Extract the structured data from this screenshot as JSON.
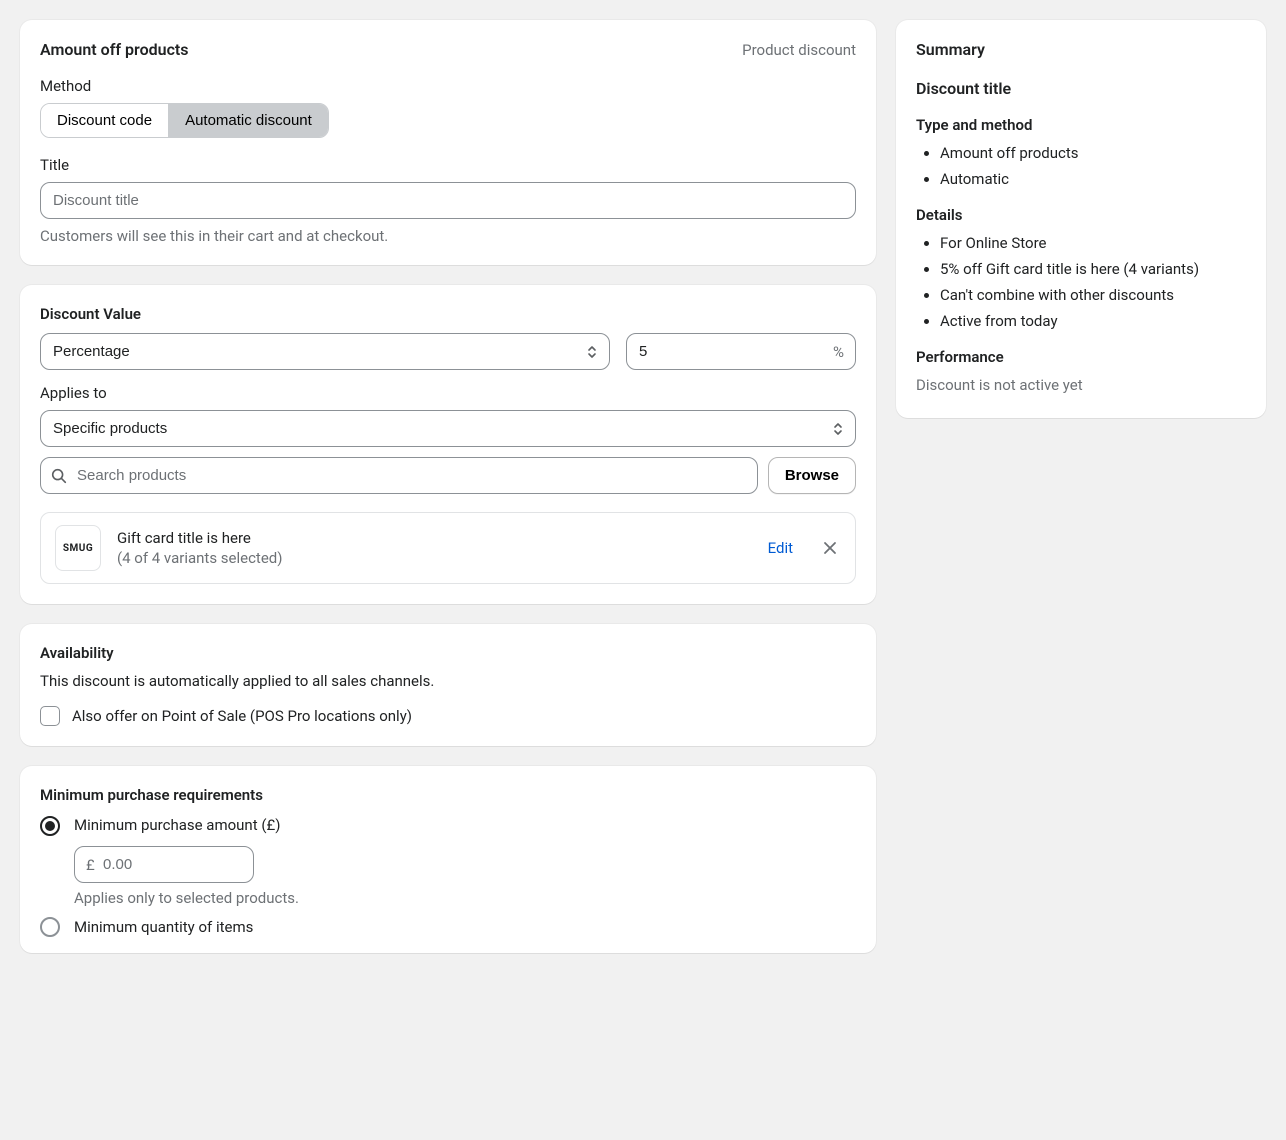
{
  "header": {
    "title": "Amount off products",
    "type_label": "Product discount"
  },
  "method": {
    "label": "Method",
    "options": [
      "Discount code",
      "Automatic discount"
    ],
    "selected_index": 1
  },
  "title_field": {
    "label": "Title",
    "placeholder": "Discount title",
    "value": "",
    "help": "Customers will see this in their cart and at checkout."
  },
  "discount_value": {
    "heading": "Discount Value",
    "type_options": [
      "Percentage"
    ],
    "type_selected": "Percentage",
    "amount": "5",
    "suffix": "%"
  },
  "applies_to": {
    "label": "Applies to",
    "options": [
      "Specific products"
    ],
    "selected": "Specific products",
    "search_placeholder": "Search products",
    "browse_label": "Browse",
    "products": [
      {
        "thumb_text": "SMUG",
        "title": "Gift card title is here",
        "subtitle": "(4 of 4 variants selected)",
        "edit_label": "Edit"
      }
    ]
  },
  "availability": {
    "heading": "Availability",
    "description": "This discount is automatically applied to all sales channels.",
    "pos_checkbox_label": "Also offer on Point of Sale (POS Pro locations only)",
    "pos_checked": false
  },
  "min_purchase": {
    "heading": "Minimum purchase requirements",
    "option_amount_label": "Minimum purchase amount (£)",
    "amount_prefix": "£",
    "amount_placeholder": "0.00",
    "amount_value": "",
    "amount_help": "Applies only to selected products.",
    "option_qty_label": "Minimum quantity of items",
    "selected": "amount"
  },
  "summary": {
    "heading": "Summary",
    "discount_title_label": "Discount title",
    "type_method_heading": "Type and method",
    "type_method_items": [
      "Amount off products",
      "Automatic"
    ],
    "details_heading": "Details",
    "details_items": [
      "For Online Store",
      "5% off Gift card title is here (4 variants)",
      "Can't combine with other discounts",
      "Active from today"
    ],
    "performance_heading": "Performance",
    "performance_text": "Discount is not active yet"
  }
}
